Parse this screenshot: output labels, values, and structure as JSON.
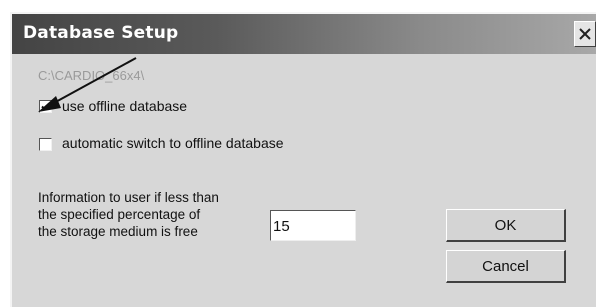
{
  "window": {
    "title": "Database Setup",
    "path": "C:\\CARDIO_66x4\\"
  },
  "options": {
    "use_offline": {
      "label": "use offline database",
      "checked": true
    },
    "auto_switch": {
      "label": "automatic switch to offline database",
      "checked": false
    }
  },
  "storage": {
    "info_lines": [
      "Information to user if less than",
      "the specified percentage of",
      "the storage medium is free"
    ],
    "percentage": "15"
  },
  "buttons": {
    "ok_label": "OK",
    "cancel_label": "Cancel"
  },
  "icons": {
    "close": "close-icon",
    "check": "check-icon",
    "annotation_arrow": "arrow-icon"
  }
}
